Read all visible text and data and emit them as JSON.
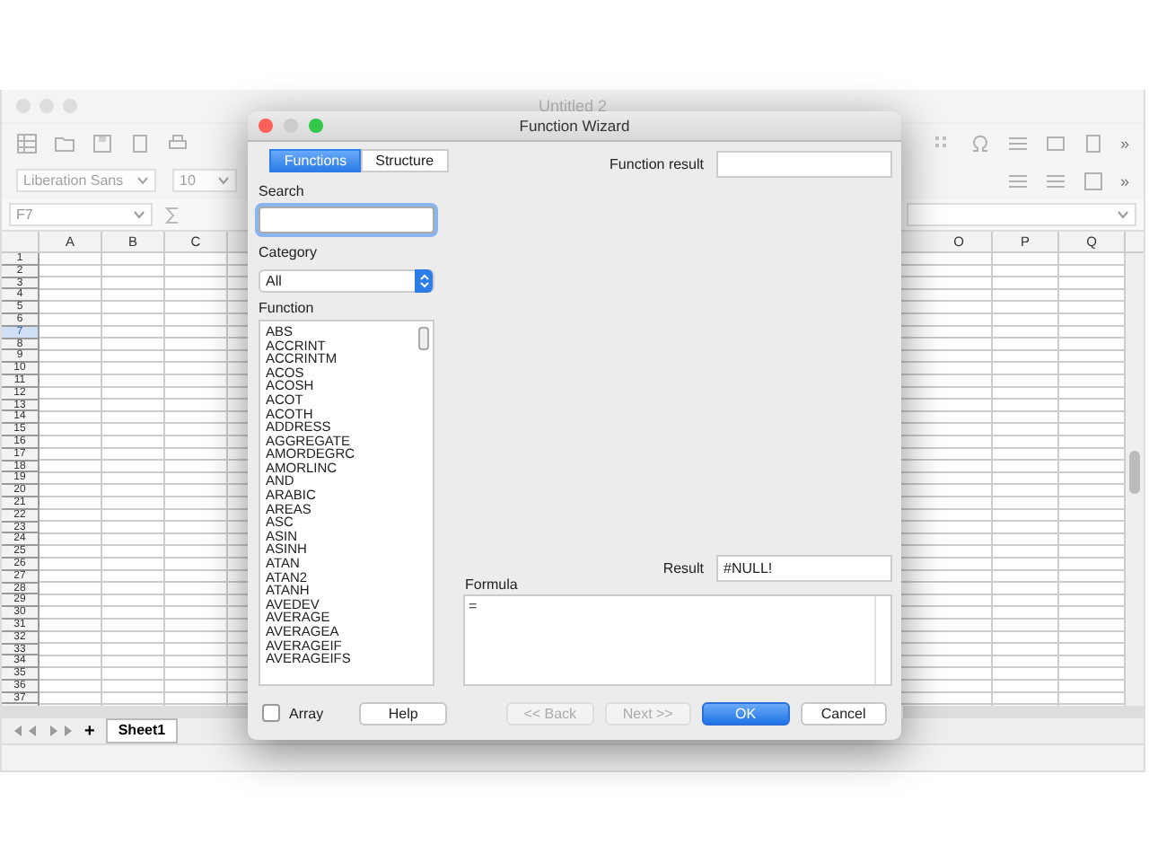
{
  "app": {
    "title": "Untitled 2",
    "font_name": "Liberation Sans",
    "font_size": "10",
    "cell_ref": "F7",
    "overflow": [
      "»",
      "»"
    ],
    "columns_left": [
      "A",
      "B",
      "C"
    ],
    "columns_right": [
      "O",
      "P",
      "Q"
    ],
    "rows": [
      {
        "label": "1",
        "selected": false
      },
      {
        "label": "2",
        "selected": false
      },
      {
        "label": "3",
        "selected": false
      },
      {
        "label": "4",
        "selected": false
      },
      {
        "label": "5",
        "selected": false
      },
      {
        "label": "6",
        "selected": false
      },
      {
        "label": "7",
        "selected": true
      },
      {
        "label": "8",
        "selected": false
      },
      {
        "label": "9",
        "selected": false
      },
      {
        "label": "10",
        "selected": false
      },
      {
        "label": "11",
        "selected": false
      },
      {
        "label": "12",
        "selected": false
      },
      {
        "label": "13",
        "selected": false
      },
      {
        "label": "14",
        "selected": false
      },
      {
        "label": "15",
        "selected": false
      },
      {
        "label": "16",
        "selected": false
      },
      {
        "label": "17",
        "selected": false
      },
      {
        "label": "18",
        "selected": false
      },
      {
        "label": "19",
        "selected": false
      },
      {
        "label": "20",
        "selected": false
      },
      {
        "label": "21",
        "selected": false
      },
      {
        "label": "22",
        "selected": false
      },
      {
        "label": "23",
        "selected": false
      },
      {
        "label": "24",
        "selected": false
      },
      {
        "label": "25",
        "selected": false
      },
      {
        "label": "26",
        "selected": false
      },
      {
        "label": "27",
        "selected": false
      },
      {
        "label": "28",
        "selected": false
      },
      {
        "label": "29",
        "selected": false
      },
      {
        "label": "30",
        "selected": false
      },
      {
        "label": "31",
        "selected": false
      },
      {
        "label": "32",
        "selected": false
      },
      {
        "label": "33",
        "selected": false
      },
      {
        "label": "34",
        "selected": false
      },
      {
        "label": "35",
        "selected": false
      },
      {
        "label": "36",
        "selected": false
      },
      {
        "label": "37",
        "selected": false
      }
    ],
    "add_sheet": "+",
    "sheet_tabs": [
      {
        "label": "Sheet1",
        "selected": true
      }
    ]
  },
  "dialog": {
    "title": "Function Wizard",
    "tabs": [
      {
        "label": "Functions",
        "selected": true
      },
      {
        "label": "Structure",
        "selected": false
      }
    ],
    "search_label": "Search",
    "category_label": "Category",
    "category": "All",
    "function_label": "Function",
    "functions": [
      {
        "name": "ABS",
        "selected": false
      },
      {
        "name": "ACCRINT",
        "selected": false
      },
      {
        "name": "ACCRINTM",
        "selected": false
      },
      {
        "name": "ACOS",
        "selected": false
      },
      {
        "name": "ACOSH",
        "selected": false
      },
      {
        "name": "ACOT",
        "selected": false
      },
      {
        "name": "ACOTH",
        "selected": false
      },
      {
        "name": "ADDRESS",
        "selected": false
      },
      {
        "name": "AGGREGATE",
        "selected": false
      },
      {
        "name": "AMORDEGRC",
        "selected": false
      },
      {
        "name": "AMORLINC",
        "selected": false
      },
      {
        "name": "AND",
        "selected": false
      },
      {
        "name": "ARABIC",
        "selected": false
      },
      {
        "name": "AREAS",
        "selected": false
      },
      {
        "name": "ASC",
        "selected": false
      },
      {
        "name": "ASIN",
        "selected": false
      },
      {
        "name": "ASINH",
        "selected": false
      },
      {
        "name": "ATAN",
        "selected": false
      },
      {
        "name": "ATAN2",
        "selected": false
      },
      {
        "name": "ATANH",
        "selected": false
      },
      {
        "name": "AVEDEV",
        "selected": false
      },
      {
        "name": "AVERAGE",
        "selected": false
      },
      {
        "name": "AVERAGEA",
        "selected": false
      },
      {
        "name": "AVERAGEIF",
        "selected": false
      },
      {
        "name": "AVERAGEIFS",
        "selected": false
      }
    ],
    "array": {
      "label": "Array",
      "checked": false
    },
    "function_result_label": "Function result",
    "result_label": "Result",
    "result": "#NULL!",
    "formula_label": "Formula",
    "formula": "=",
    "buttons": [
      {
        "label": "Help",
        "disabled": false,
        "default": false
      },
      {
        "label": "<< Back",
        "disabled": true,
        "default": false
      },
      {
        "label": "Next >>",
        "disabled": true,
        "default": false
      },
      {
        "label": "OK",
        "disabled": false,
        "default": true
      },
      {
        "label": "Cancel",
        "disabled": false,
        "default": false
      }
    ]
  }
}
